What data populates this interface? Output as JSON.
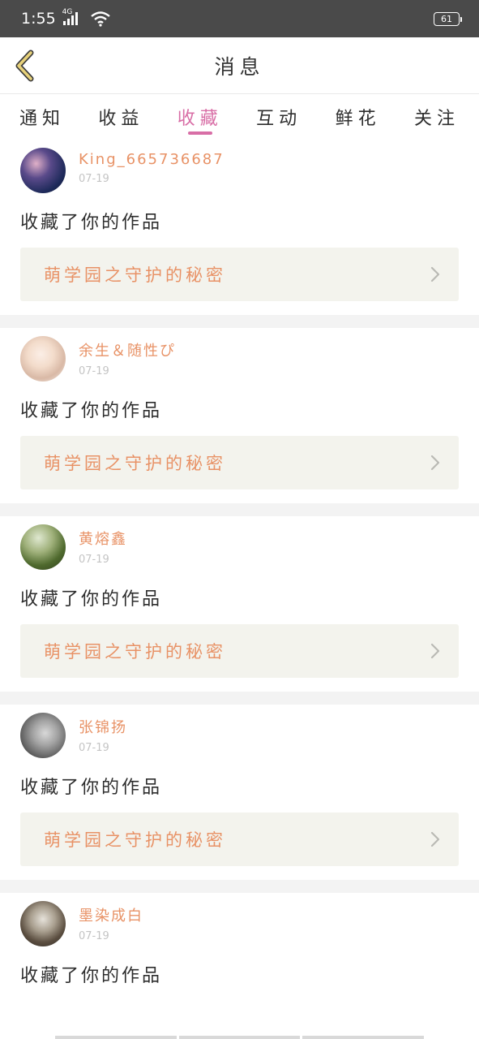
{
  "status": {
    "time": "1:55",
    "network": "4G",
    "battery": "61"
  },
  "header": {
    "title": "消息"
  },
  "tabs": [
    {
      "label": "通知",
      "active": false
    },
    {
      "label": "收益",
      "active": false
    },
    {
      "label": "收藏",
      "active": true
    },
    {
      "label": "互动",
      "active": false
    },
    {
      "label": "鲜花",
      "active": false
    },
    {
      "label": "关注",
      "active": false
    }
  ],
  "items": [
    {
      "username": "King_665736687",
      "date": "07-19",
      "action": "收藏了你的作品",
      "work": "萌学园之守护的秘密"
    },
    {
      "username": "余生＆随性ぴ",
      "date": "07-19",
      "action": "收藏了你的作品",
      "work": "萌学园之守护的秘密"
    },
    {
      "username": "黄熔鑫",
      "date": "07-19",
      "action": "收藏了你的作品",
      "work": "萌学园之守护的秘密"
    },
    {
      "username": "张锦扬",
      "date": "07-19",
      "action": "收藏了你的作品",
      "work": "萌学园之守护的秘密"
    },
    {
      "username": "墨染成白",
      "date": "07-19",
      "action": "收藏了你的作品",
      "work": ""
    }
  ],
  "colors": {
    "accent_pink": "#d86ea6",
    "accent_orange": "#e89266",
    "back_arrow": "#e7d17a",
    "work_bg": "#f3f3ed"
  },
  "icons": {
    "back": "chevron-left-icon",
    "work_link": "chevron-right-icon",
    "signal": "signal-icon",
    "wifi": "wifi-icon",
    "battery": "battery-icon"
  }
}
